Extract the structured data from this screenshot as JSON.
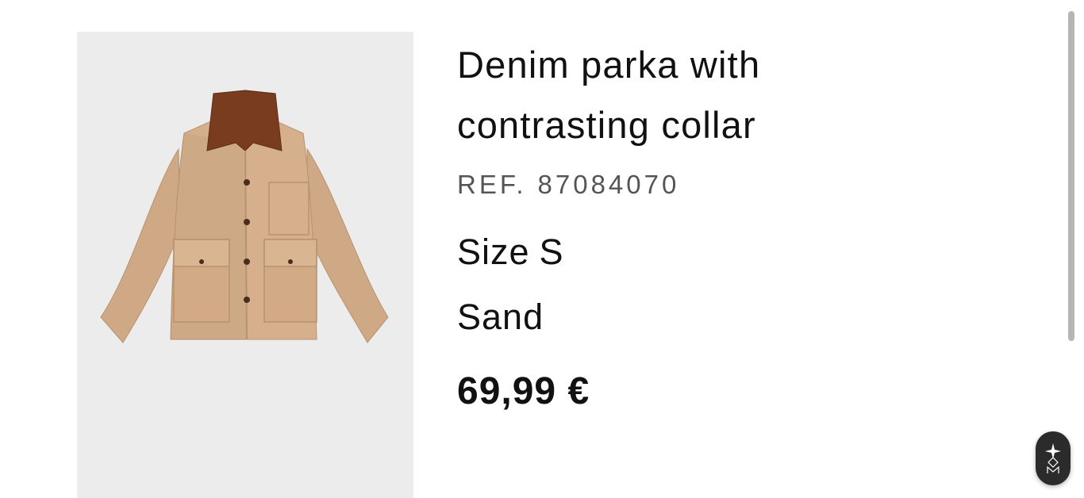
{
  "product": {
    "title_line1": "Denim parka with",
    "title_line2": "contrasting collar",
    "ref_label": "REF.",
    "ref_number": "87084070",
    "size_label": "Size",
    "size_value": "S",
    "color": "Sand",
    "price": "69,99 €"
  },
  "image": {
    "subject": "jacket-photo",
    "background_color": "#ececec",
    "jacket_color": "#d6b08c",
    "collar_color": "#7a3c1f"
  },
  "widgets": {
    "floating_badge_icon": "sparkle-logo-icon"
  }
}
